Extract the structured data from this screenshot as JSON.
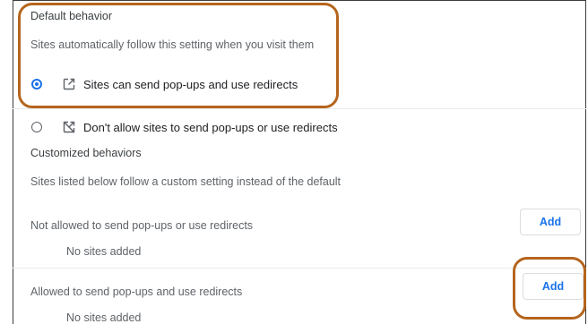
{
  "default_behavior": {
    "heading": "Default behavior",
    "description": "Sites automatically follow this setting when you visit them",
    "options": [
      {
        "label": "Sites can send pop-ups and use redirects",
        "selected": true,
        "icon": "popup-open-icon"
      },
      {
        "label": "Don't allow sites to send pop-ups or use redirects",
        "selected": false,
        "icon": "popup-blocked-icon"
      }
    ]
  },
  "customized_behaviors": {
    "heading": "Customized behaviors",
    "description": "Sites listed below follow a custom setting instead of the default",
    "not_allowed": {
      "label": "Not allowed to send pop-ups or use redirects",
      "empty_text": "No sites added",
      "add_label": "Add"
    },
    "allowed": {
      "label": "Allowed to send pop-ups and use redirects",
      "empty_text": "No sites added",
      "add_label": "Add"
    }
  },
  "colors": {
    "accent": "#1a73e8",
    "callout": "#b5651d"
  }
}
